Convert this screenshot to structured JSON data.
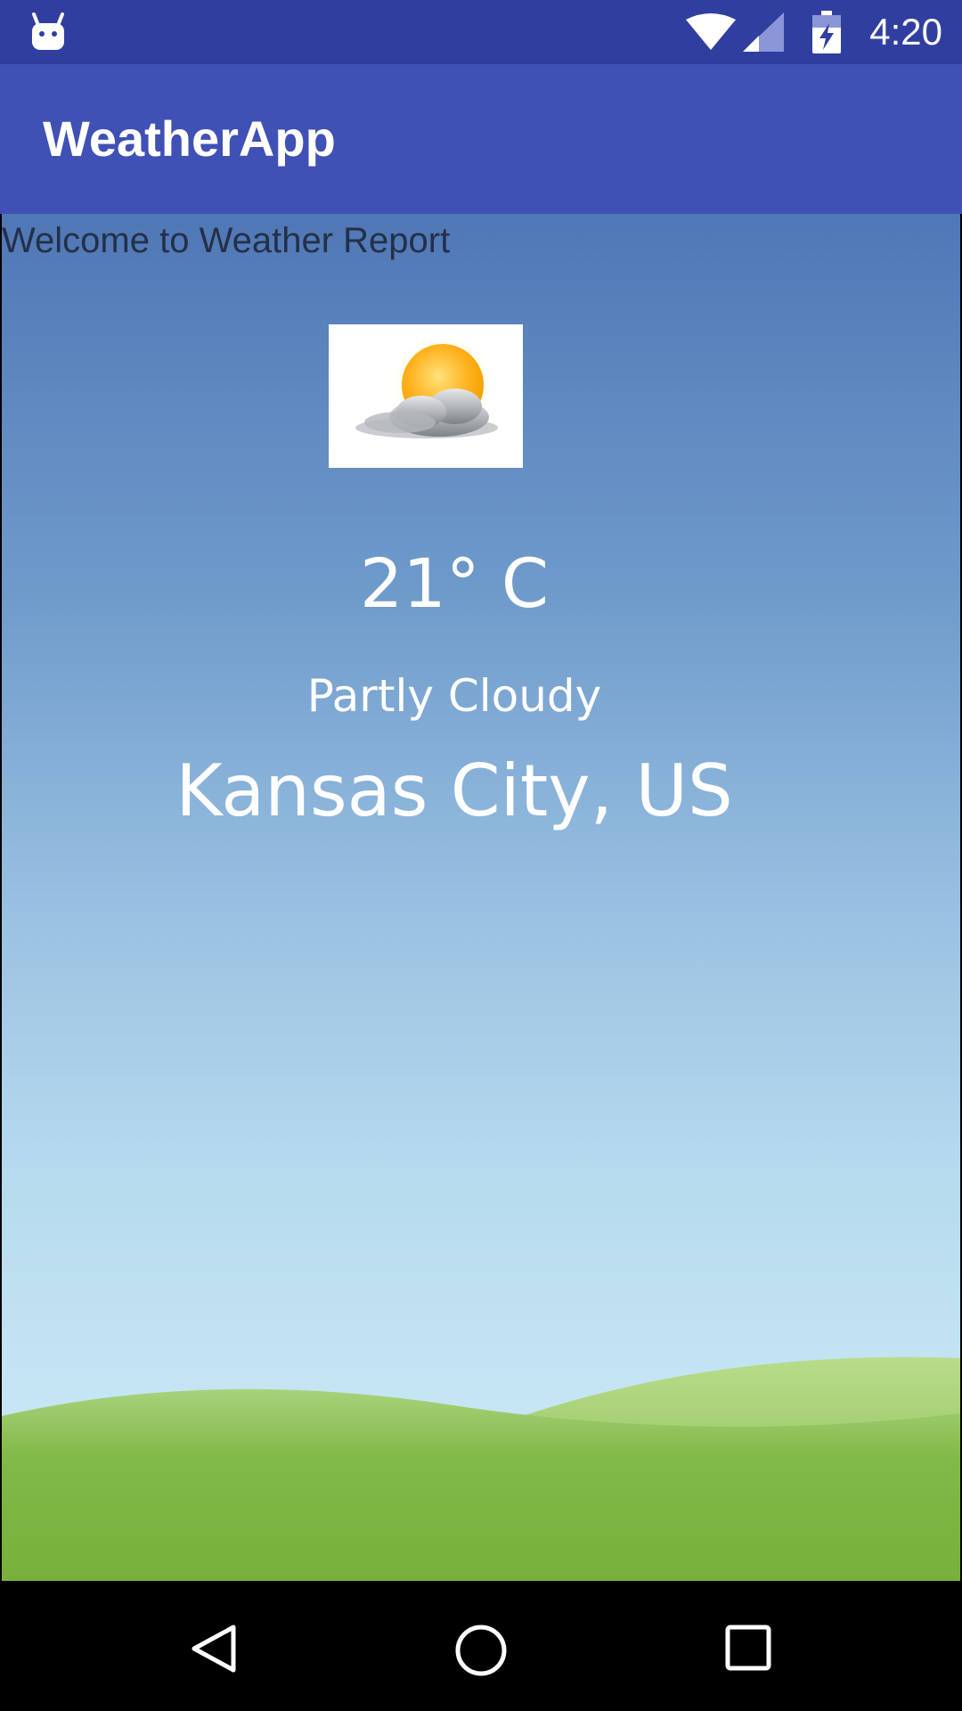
{
  "status_bar": {
    "time": "4:20",
    "icons": [
      "android-icon",
      "wifi-icon",
      "signal-icon",
      "battery-charging-icon"
    ]
  },
  "app_bar": {
    "title": "WeatherApp"
  },
  "main": {
    "welcome_text": "Welcome to Weather Report",
    "weather_icon": "partly-cloudy-icon",
    "temperature": "21° C",
    "condition": "Partly Cloudy",
    "city": "Kansas City, US"
  },
  "nav_bar": {
    "icons": [
      "back-icon",
      "home-icon",
      "recents-icon"
    ]
  },
  "colors": {
    "status_bar": "#303f9f",
    "app_bar": "#3f51b5",
    "sky_top": "#5077b6",
    "sky_bottom": "#cfeaf5",
    "grass": "#7bb542"
  }
}
